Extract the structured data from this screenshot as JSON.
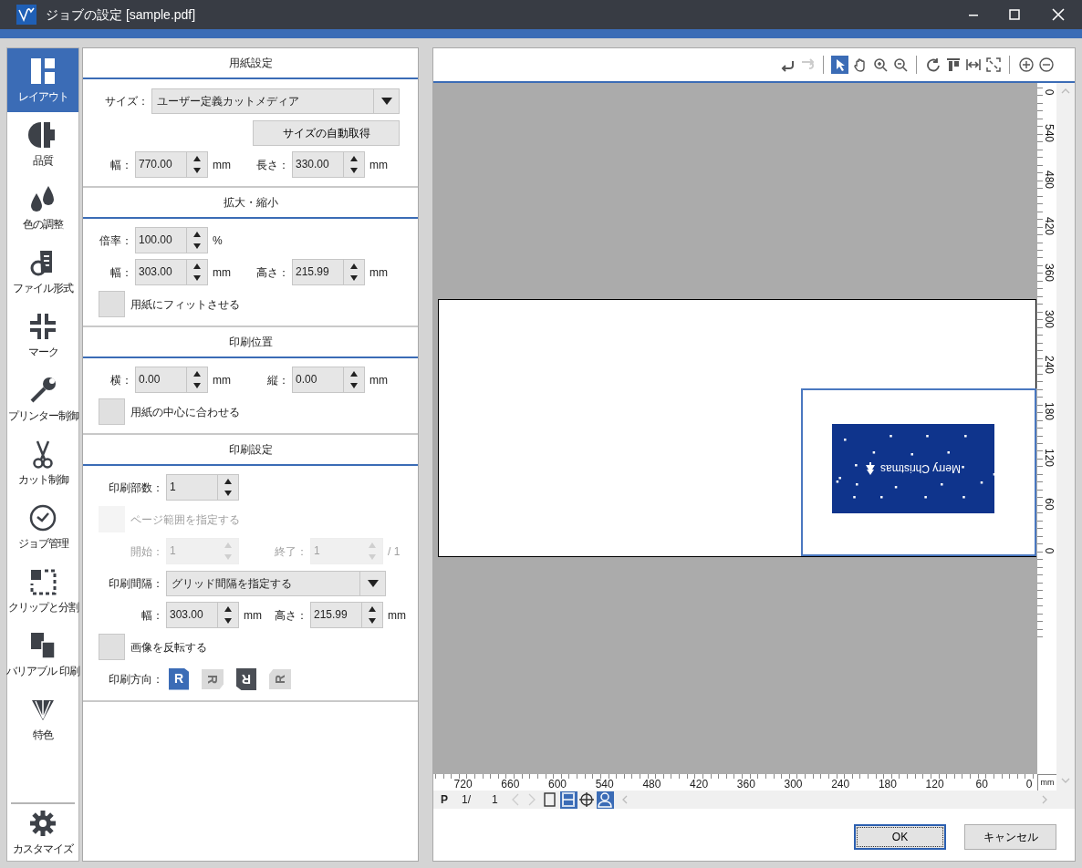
{
  "window": {
    "title": "ジョブの設定 [sample.pdf]"
  },
  "sidebar": {
    "items": [
      {
        "label": "レイアウト",
        "selected": true
      },
      {
        "label": "品質",
        "selected": false
      },
      {
        "label": "色の調整",
        "selected": false
      },
      {
        "label": "ファイル形式",
        "selected": false
      },
      {
        "label": "マーク",
        "selected": false
      },
      {
        "label": "プリンター制御",
        "selected": false
      },
      {
        "label": "カット制御",
        "selected": false
      },
      {
        "label": "ジョブ管理",
        "selected": false
      },
      {
        "label": "クリップと分割",
        "selected": false
      },
      {
        "label": "バリアブル 印刷",
        "selected": false
      },
      {
        "label": "特色",
        "selected": false
      }
    ],
    "footer_item": {
      "label": "カスタマイズ",
      "selected": false
    }
  },
  "sections": [
    {
      "title": "用紙設定",
      "rows": [
        {
          "kind": "select",
          "label": "サイズ：",
          "value": "ユーザー定義カットメディア"
        },
        {
          "kind": "button",
          "label": "サイズの自動取得"
        },
        {
          "kind": "spinners",
          "fields": [
            {
              "label": "幅：",
              "value": "770.00",
              "unit": "mm",
              "disabled": false
            },
            {
              "label": "長さ：",
              "value": "330.00",
              "unit": "mm",
              "disabled": false
            }
          ]
        }
      ]
    },
    {
      "title": "拡大・縮小",
      "rows": [
        {
          "kind": "spinners",
          "fields": [
            {
              "label": "倍率：",
              "value": "100.00",
              "unit": "%",
              "disabled": false
            }
          ]
        },
        {
          "kind": "spinners",
          "fields": [
            {
              "label": "幅：",
              "value": "303.00",
              "unit": "mm",
              "disabled": false
            },
            {
              "label": "高さ：",
              "value": "215.99",
              "unit": "mm",
              "disabled": false
            }
          ]
        },
        {
          "kind": "checkbox",
          "label": "用紙にフィットさせる",
          "checked": false,
          "disabled": false
        }
      ]
    },
    {
      "title": "印刷位置",
      "rows": [
        {
          "kind": "spinners",
          "fields": [
            {
              "label": "横：",
              "value": "0.00",
              "unit": "mm",
              "disabled": false
            },
            {
              "label": "縦：",
              "value": "0.00",
              "unit": "mm",
              "disabled": false
            }
          ]
        },
        {
          "kind": "checkbox",
          "label": "用紙の中心に合わせる",
          "checked": false,
          "disabled": false
        }
      ]
    },
    {
      "title": "印刷設定",
      "rows": [
        {
          "kind": "spinners",
          "fields": [
            {
              "label": "印刷部数：",
              "value": "1",
              "disabled": false
            }
          ]
        },
        {
          "kind": "checkbox",
          "label": "ページ範囲を指定する",
          "checked": false,
          "disabled": true
        },
        {
          "kind": "spinners",
          "fields": [
            {
              "label": "開始：",
              "value": "1",
              "disabled": true
            },
            {
              "label": "終了：",
              "value": "1",
              "unit": "/ 1",
              "disabled": true
            }
          ]
        },
        {
          "kind": "select",
          "label": "印刷間隔：",
          "value": "グリッド間隔を指定する"
        },
        {
          "kind": "spinners",
          "fields": [
            {
              "label": "幅：",
              "value": "303.00",
              "unit": "mm",
              "disabled": false
            },
            {
              "label": "高さ：",
              "value": "215.99",
              "unit": "mm",
              "disabled": false
            }
          ]
        },
        {
          "kind": "checkbox",
          "label": "画像を反転する",
          "checked": false,
          "disabled": false
        },
        {
          "kind": "orientation",
          "label": "印刷方向：",
          "options": [
            {
              "glyph": "R",
              "selected": true,
              "disabled": false
            },
            {
              "glyph": "R",
              "selected": false,
              "disabled": true
            },
            {
              "glyph": "R",
              "selected": false,
              "disabled": false
            },
            {
              "glyph": "R",
              "selected": false,
              "disabled": true
            }
          ]
        }
      ]
    }
  ],
  "toolbar": [
    {
      "kind": "undo",
      "selected": false,
      "disabled": false
    },
    {
      "kind": "redo",
      "selected": false,
      "disabled": true
    },
    {
      "kind": "separator"
    },
    {
      "kind": "pointer",
      "selected": true,
      "disabled": false
    },
    {
      "kind": "hand",
      "selected": false,
      "disabled": false
    },
    {
      "kind": "zoom-in",
      "selected": false,
      "disabled": false
    },
    {
      "kind": "zoom-out",
      "selected": false,
      "disabled": false
    },
    {
      "kind": "separator"
    },
    {
      "kind": "rotate",
      "selected": false,
      "disabled": false
    },
    {
      "kind": "align-top",
      "selected": false,
      "disabled": false
    },
    {
      "kind": "fit-width",
      "selected": false,
      "disabled": false
    },
    {
      "kind": "fit-page",
      "selected": false,
      "disabled": false
    },
    {
      "kind": "separator"
    },
    {
      "kind": "plus",
      "selected": false,
      "disabled": false
    },
    {
      "kind": "minus",
      "selected": false,
      "disabled": false
    }
  ],
  "preview": {
    "artwork_text": "Merry Christmas",
    "selected": true
  },
  "rulers": {
    "horizontal": [
      "720",
      "660",
      "600",
      "540",
      "480",
      "420",
      "360",
      "300",
      "240",
      "180",
      "120",
      "60",
      "0"
    ],
    "vertical": [
      "0",
      "540",
      "480",
      "420",
      "360",
      "300",
      "240",
      "180",
      "120",
      "60",
      "0"
    ],
    "unit": "mm"
  },
  "page_nav": {
    "prefix": "P",
    "current": "1/",
    "total": "1"
  },
  "view_buttons": [
    {
      "kind": "single-page",
      "selected": false
    },
    {
      "kind": "fit-height",
      "selected": true
    },
    {
      "kind": "crosshair",
      "selected": false
    },
    {
      "kind": "person",
      "selected": true
    }
  ],
  "dialog_buttons": [
    {
      "label": "OK",
      "default": true
    },
    {
      "label": "キャンセル",
      "default": false
    }
  ]
}
